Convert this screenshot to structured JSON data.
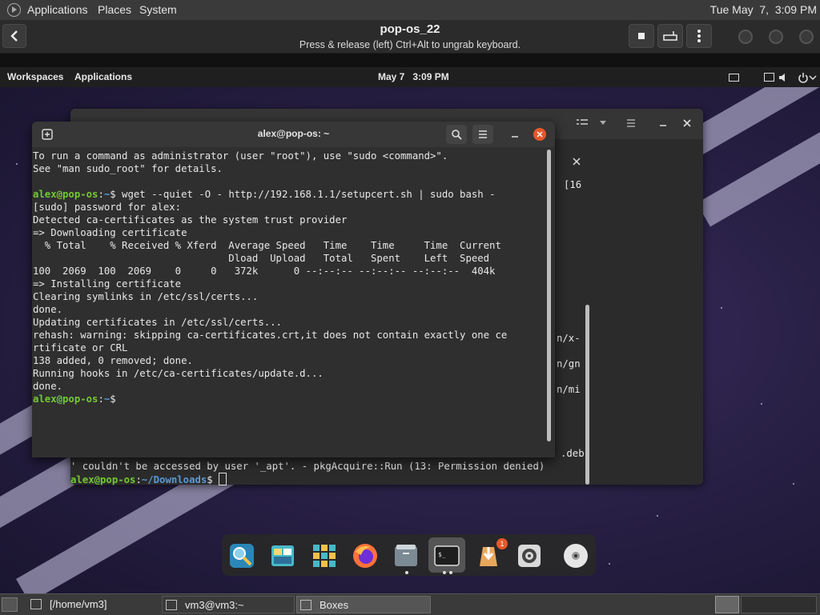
{
  "host_panel": {
    "menus": [
      "Applications",
      "Places",
      "System"
    ],
    "clock": "Tue May  7,  3:09 PM"
  },
  "boxes_header": {
    "title": "pop-os_22",
    "subtitle": "Press & release (left) Ctrl+Alt to ungrab keyboard.",
    "icons": [
      "back-arrow-icon",
      "stop-icon",
      "keyboard-icon",
      "kebab-menu-icon"
    ]
  },
  "guest_panel": {
    "workspaces": "Workspaces",
    "applications": "Applications",
    "clock": "May 7   3:09 PM"
  },
  "bg_terminal": {
    "right_fragments": [
      "[16",
      "n/x-",
      "n/gn",
      "n/mi",
      ".deb"
    ],
    "bottom_line_1": "' couldn't be accessed by user '_apt'. - pkgAcquire::Run (13: Permission denied)",
    "prompt_user": "alex@pop-os",
    "prompt_colon": ":",
    "prompt_path": "~/Downloads",
    "prompt_dollar": "$"
  },
  "fg_terminal": {
    "title": "alex@pop-os: ~",
    "lines": [
      {
        "text": "To run a command as administrator (user \"root\"), use \"sudo <command>\"."
      },
      {
        "text": "See \"man sudo_root\" for details."
      },
      {
        "text": ""
      },
      {
        "user": "alex@pop-os",
        "path": "~",
        "cmd": " wget --quiet -O - http://192.168.1.1/setupcert.sh | sudo bash -"
      },
      {
        "text": "[sudo] password for alex:"
      },
      {
        "text": "Detected ca-certificates as the system trust provider"
      },
      {
        "text": "=> Downloading certificate"
      },
      {
        "text": "  % Total    % Received % Xferd  Average Speed   Time    Time     Time  Current"
      },
      {
        "text": "                                 Dload  Upload   Total   Spent    Left  Speed"
      },
      {
        "text": "100  2069  100  2069    0     0   372k      0 --:--:-- --:--:-- --:--:--  404k"
      },
      {
        "text": "=> Installing certificate"
      },
      {
        "text": "Clearing symlinks in /etc/ssl/certs..."
      },
      {
        "text": "done."
      },
      {
        "text": "Updating certificates in /etc/ssl/certs..."
      },
      {
        "text": "rehash: warning: skipping ca-certificates.crt,it does not contain exactly one ce"
      },
      {
        "text": "rtificate or CRL"
      },
      {
        "text": "138 added, 0 removed; done."
      },
      {
        "text": "Running hooks in /etc/ca-certificates/update.d..."
      },
      {
        "text": "done."
      },
      {
        "user": "alex@pop-os",
        "path": "~",
        "cmd": ""
      }
    ]
  },
  "dock": {
    "items": [
      "search-launcher-icon",
      "workspaces-icon",
      "app-grid-icon",
      "firefox-icon",
      "files-icon",
      "terminal-icon",
      "pop-shop-icon",
      "settings-icon",
      "disc-icon"
    ],
    "shop_badge": "1"
  },
  "taskbar": {
    "tasks": [
      "[/home/vm3]",
      "vm3@vm3:~",
      "Boxes"
    ]
  },
  "colors": {
    "prompt_green": "#73c936",
    "prompt_blue": "#5a9ad6",
    "close_orange": "#e8572a"
  }
}
